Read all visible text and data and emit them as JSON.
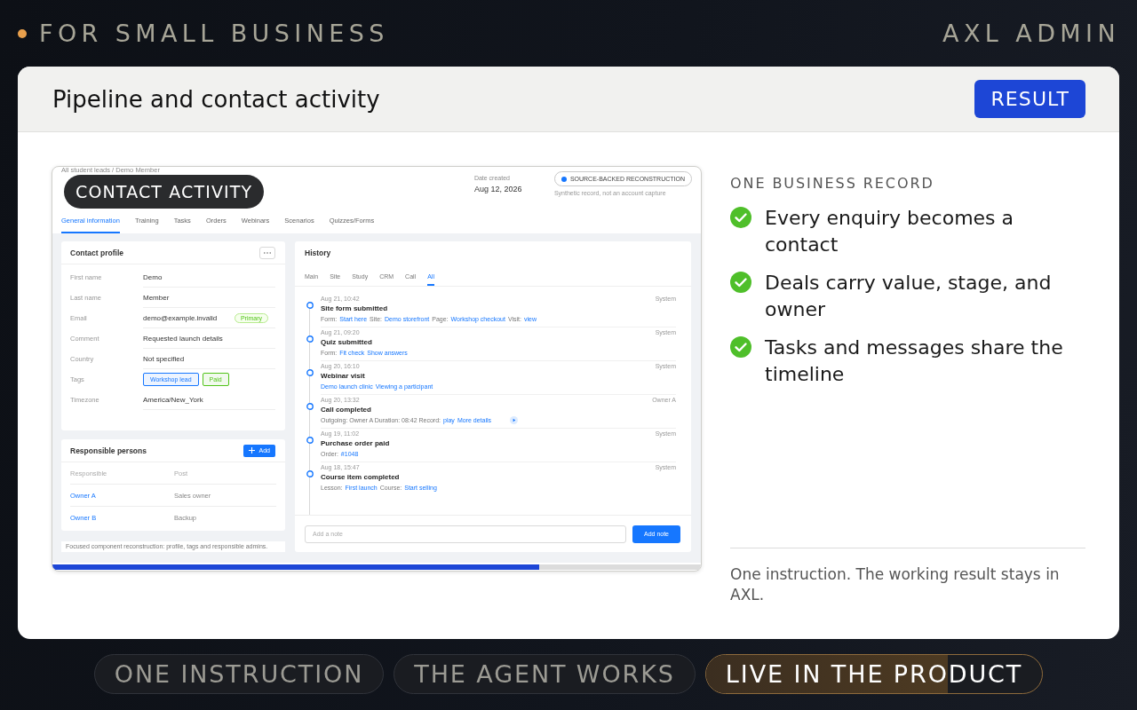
{
  "top_bar": {
    "tagline": "FOR SMALL BUSINESS",
    "brand": "AXL ADMIN"
  },
  "card": {
    "title": "Pipeline and contact activity",
    "result_button": "RESULT"
  },
  "screenshot": {
    "overlay_label": "CONTACT ACTIVITY",
    "breadcrumb": "All student leads / Demo Member",
    "date_created": {
      "label": "Date created",
      "value": "Aug 12, 2026"
    },
    "source_badge": "SOURCE-BACKED RECONSTRUCTION",
    "source_note": "Synthetic record, not an account capture",
    "tabs": [
      {
        "label": "General information",
        "selected": true
      },
      {
        "label": "Training",
        "selected": false
      },
      {
        "label": "Tasks",
        "selected": false
      },
      {
        "label": "Orders",
        "selected": false
      },
      {
        "label": "Webinars",
        "selected": false
      },
      {
        "label": "Scenarios",
        "selected": false
      },
      {
        "label": "Quizzes/Forms",
        "selected": false
      }
    ],
    "contact_profile": {
      "title": "Contact profile",
      "fields": [
        {
          "label": "First name",
          "kind": "text",
          "value": "Demo"
        },
        {
          "label": "Last name",
          "kind": "text",
          "value": "Member"
        },
        {
          "label": "Email",
          "kind": "text",
          "value": "demo@example.invalid",
          "badge": "Primary"
        },
        {
          "label": "Comment",
          "kind": "text",
          "value": "Requested launch details"
        },
        {
          "label": "Country",
          "kind": "text",
          "value": "Not specified"
        },
        {
          "label": "Tags",
          "kind": "tags",
          "tags": [
            {
              "text": "Workshop lead",
              "color": "#1677ff"
            },
            {
              "text": "Paid",
              "color": "#52c41a"
            }
          ]
        },
        {
          "label": "Timezone",
          "kind": "text",
          "value": "America/New_York"
        }
      ]
    },
    "responsible": {
      "title": "Responsible persons",
      "add_button": "Add",
      "columns": [
        "Responsible",
        "Post"
      ],
      "rows": [
        {
          "name": "Owner A",
          "post": "Sales owner"
        },
        {
          "name": "Owner B",
          "post": "Backup"
        }
      ]
    },
    "footnote": "Focused component reconstruction: profile, tags and responsible admins.",
    "history": {
      "title": "History",
      "tabs": [
        {
          "label": "Main",
          "selected": false
        },
        {
          "label": "Site",
          "selected": false
        },
        {
          "label": "Study",
          "selected": false
        },
        {
          "label": "CRM",
          "selected": false
        },
        {
          "label": "Call",
          "selected": false
        },
        {
          "label": "All",
          "selected": true
        }
      ],
      "events": [
        {
          "time": "Aug 21, 10:42",
          "actor": "System",
          "title": "Site form submitted",
          "detail": [
            {
              "kind": "text",
              "text": "Form:"
            },
            {
              "kind": "link",
              "text": "Start here"
            },
            {
              "kind": "text",
              "text": "Site:"
            },
            {
              "kind": "link",
              "text": "Demo storefront"
            },
            {
              "kind": "text",
              "text": "Page:"
            },
            {
              "kind": "link",
              "text": "Workshop checkout"
            },
            {
              "kind": "text",
              "text": "Visit:"
            },
            {
              "kind": "link",
              "text": "view"
            }
          ]
        },
        {
          "time": "Aug 21, 09:20",
          "actor": "System",
          "title": "Quiz submitted",
          "detail": [
            {
              "kind": "text",
              "text": "Form:"
            },
            {
              "kind": "link",
              "text": "Fit check"
            },
            {
              "kind": "link",
              "text": "Show answers"
            }
          ]
        },
        {
          "time": "Aug 20, 16:10",
          "actor": "System",
          "title": "Webinar visit",
          "detail": [
            {
              "kind": "link",
              "text": "Demo launch clinic"
            },
            {
              "kind": "link",
              "text": "Viewing a participant"
            }
          ]
        },
        {
          "time": "Aug 20, 13:32",
          "actor": "Owner A",
          "title": "Call completed",
          "detail": [
            {
              "kind": "text",
              "text": "Outgoing: Owner A Duration: 08:42 Record:"
            },
            {
              "kind": "link",
              "text": "play"
            },
            {
              "kind": "link",
              "text": "More details"
            },
            {
              "kind": "play"
            }
          ]
        },
        {
          "time": "Aug 19, 11:02",
          "actor": "System",
          "title": "Purchase order paid",
          "detail": [
            {
              "kind": "text",
              "text": "Order:"
            },
            {
              "kind": "link",
              "text": "#1048"
            }
          ]
        },
        {
          "time": "Aug 18, 15:47",
          "actor": "System",
          "title": "Course item completed",
          "detail": [
            {
              "kind": "text",
              "text": "Lesson:"
            },
            {
              "kind": "link",
              "text": "First launch"
            },
            {
              "kind": "text",
              "text": "Course:"
            },
            {
              "kind": "link",
              "text": "Start selling"
            }
          ]
        }
      ],
      "note_placeholder": "Add a note",
      "note_button": "Add note"
    },
    "progress": {
      "level": 0.75
    }
  },
  "summary": {
    "heading": "ONE BUSINESS RECORD",
    "points": [
      "Every enquiry becomes a contact",
      "Deals carry value, stage, and owner",
      "Tasks and messages share the timeline"
    ],
    "footer": "One instruction. The working result stays in AXL."
  },
  "steps": [
    {
      "label": "ONE INSTRUCTION",
      "selected": false
    },
    {
      "label": "THE AGENT WORKS",
      "selected": false
    },
    {
      "label": "LIVE IN THE PRODUCT",
      "selected": true,
      "level": 0.72
    }
  ]
}
